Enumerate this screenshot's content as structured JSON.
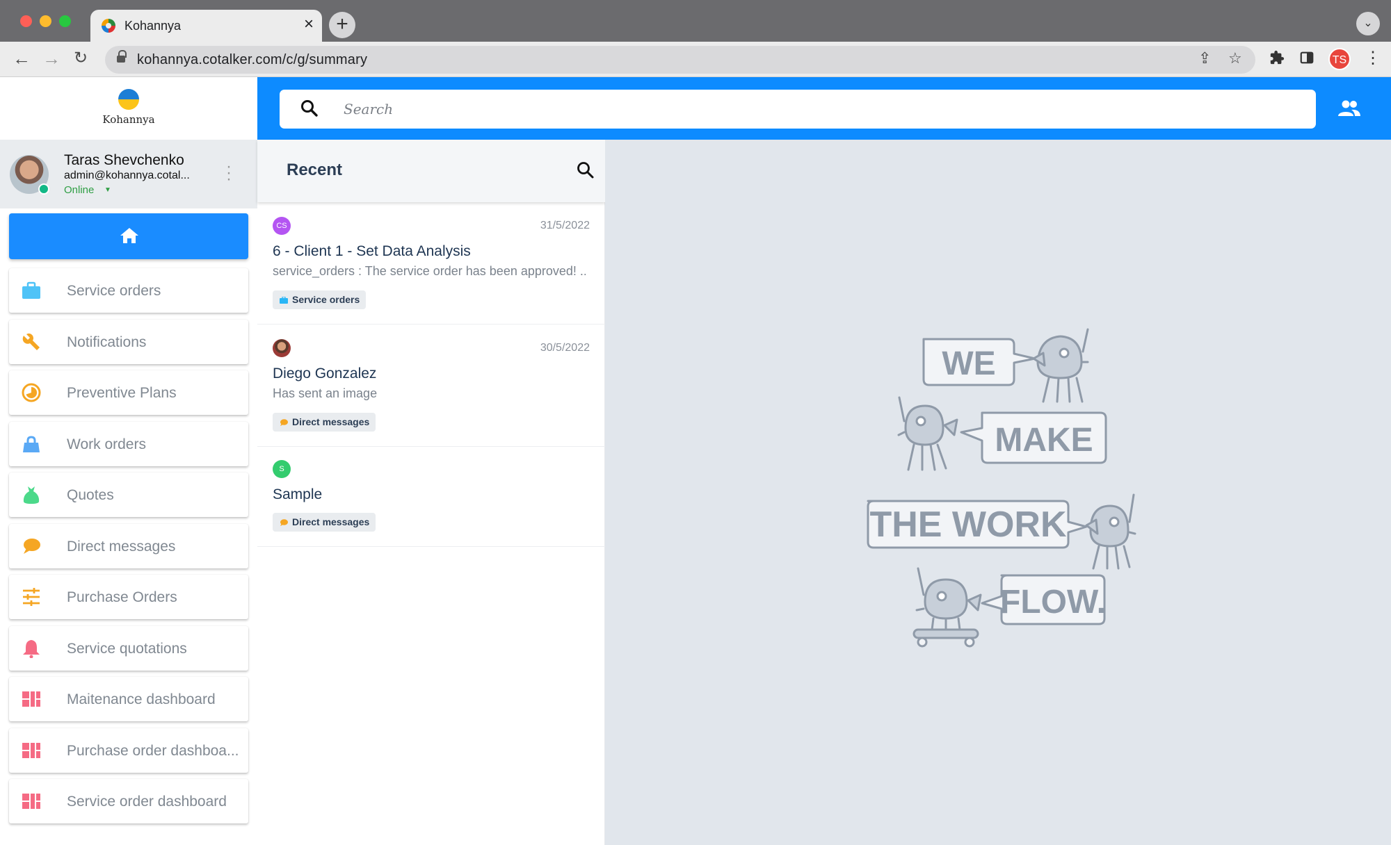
{
  "browser": {
    "tab_title": "Kohannya",
    "url": "kohannya.cotalker.com/c/g/summary",
    "profile_initials": "TS"
  },
  "sidebar": {
    "logo_text": "Kohannya",
    "user": {
      "name": "Taras Shevchenko",
      "email": "admin@kohannya.cotal...",
      "status": "Online"
    },
    "items": [
      {
        "label": "Service orders",
        "icon": "briefcase-icon",
        "color": "#4fc3f7"
      },
      {
        "label": "Notifications",
        "icon": "wrench-icon",
        "color": "#f5a623"
      },
      {
        "label": "Preventive Plans",
        "icon": "dashboard-gauge-icon",
        "color": "#f5a623"
      },
      {
        "label": "Work orders",
        "icon": "bag-icon",
        "color": "#5aa9f5"
      },
      {
        "label": "Quotes",
        "icon": "money-bag-icon",
        "color": "#4cd98a"
      },
      {
        "label": "Direct messages",
        "icon": "chat-bubble-icon",
        "color": "#f5a623"
      },
      {
        "label": "Purchase Orders",
        "icon": "sliders-icon",
        "color": "#f5a623"
      },
      {
        "label": "Service quotations",
        "icon": "bell-icon",
        "color": "#f56b84"
      },
      {
        "label": "Maitenance dashboard",
        "icon": "dashboard-grid-icon",
        "color": "#f56b84"
      },
      {
        "label": "Purchase order dashboa...",
        "icon": "dashboard-grid-icon",
        "color": "#f56b84"
      },
      {
        "label": "Service order dashboard",
        "icon": "dashboard-grid-icon",
        "color": "#f56b84"
      }
    ]
  },
  "topbar": {
    "search_placeholder": "Search"
  },
  "recent": {
    "title": "Recent",
    "conversations": [
      {
        "avatar_text": "CS",
        "avatar_color": "#b455f2",
        "date": "31/5/2022",
        "title": "6 - Client 1 - Set Data Analysis",
        "preview": "service_orders : The service order has been approved! ...",
        "tag": "Service orders",
        "tag_color": "#29b6f6"
      },
      {
        "avatar_text": "",
        "avatar_color": "#8a5a44",
        "date": "30/5/2022",
        "title": "Diego Gonzalez",
        "preview": "Has sent an image",
        "tag": "Direct messages",
        "tag_color": "#f5a623"
      },
      {
        "avatar_text": "S",
        "avatar_color": "#33cc6e",
        "date": "",
        "title": "Sample",
        "preview": "",
        "tag": "Direct messages",
        "tag_color": "#f5a623"
      }
    ]
  },
  "illustration": {
    "words": [
      "WE",
      "MAKE",
      "THE WORK",
      "FLOW."
    ]
  },
  "colors": {
    "brand_blue": "#0d8bff",
    "main_bg": "#e1e6ec"
  }
}
